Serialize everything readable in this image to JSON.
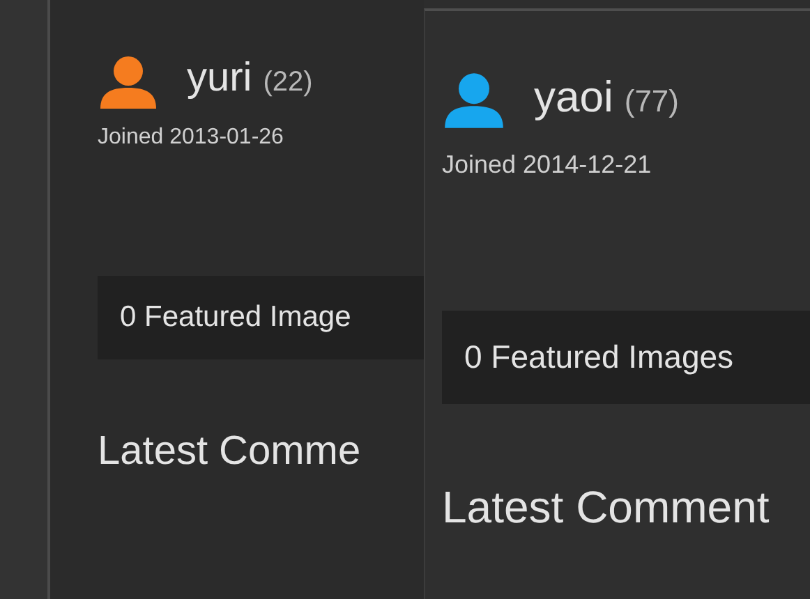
{
  "profiles": [
    {
      "name": "yuri",
      "count": "(22)",
      "color": "#f57c1f",
      "joined": "Joined 2013-01-26",
      "featured": "0 Featured Image",
      "latest_heading": "Latest Comme"
    },
    {
      "name": "yaoi",
      "count": "(77)",
      "color": "#17a6ee",
      "joined": "Joined 2014-12-21",
      "featured": "0 Featured Images",
      "latest_heading": "Latest Comment"
    }
  ]
}
